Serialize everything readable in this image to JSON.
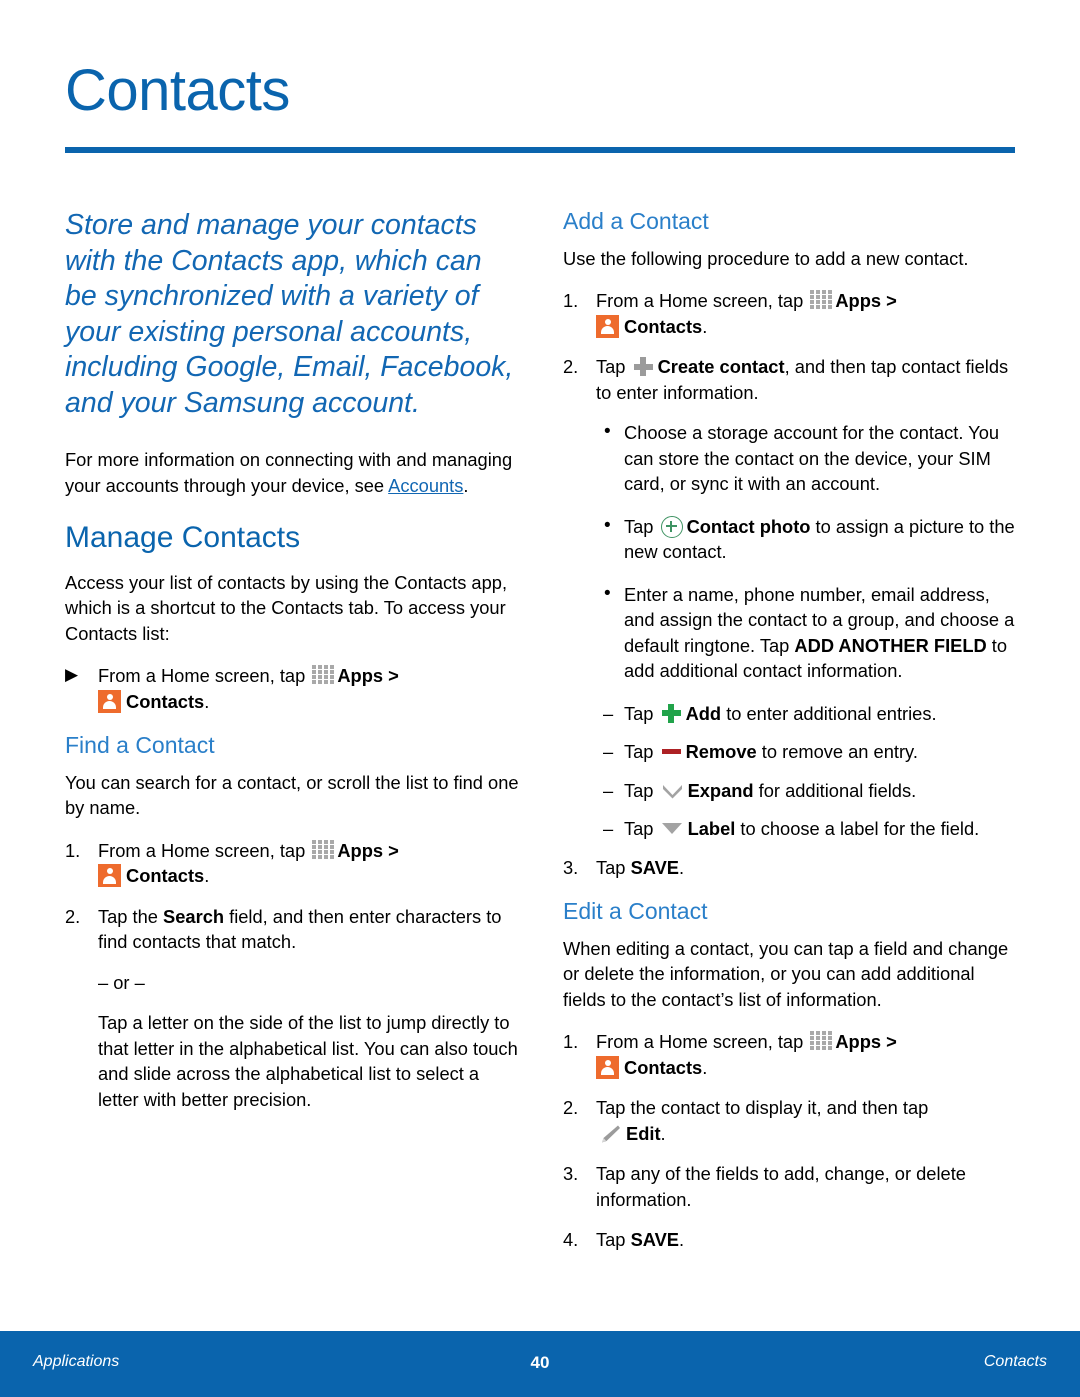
{
  "page": {
    "title": "Contacts",
    "accent_blue": "#0a64ad",
    "subheading_blue": "#2a7fc9",
    "orange": "#ee6b2d",
    "green": "#21a34a",
    "red": "#ad2124"
  },
  "left_column": {
    "lede": "Store and manage your contacts with the Contacts app, which can be synchronized with a variety of your existing personal accounts, including Google, Email, Facebook, and your Samsung account.",
    "intro_before_link": "For more information on connecting with and managing your accounts through your device, see ",
    "intro_link": "Accounts",
    "intro_after_link": ".",
    "manage_heading": "Manage Contacts",
    "manage_body": "Access your list of contacts by using the Contacts app, which is a shortcut to the Contacts tab. To access your Contacts list:",
    "manage_step": {
      "marker": "▶",
      "text_before": "From a Home screen, tap ",
      "apps_label": "Apps",
      "gt": " > ",
      "contacts_label": "Contacts",
      "period": "."
    },
    "find_heading": "Find a Contact",
    "find_body": "You can search for a contact, or scroll the list to find one by name.",
    "find_steps": [
      {
        "marker": "1.",
        "text_before": "From a Home screen, tap ",
        "apps_label": "Apps",
        "gt": " > ",
        "contacts_label": "Contacts",
        "period": "."
      },
      {
        "marker": "2.",
        "text_before": "Tap the ",
        "bold": "Search",
        "text_after": " field, and then enter characters to find contacts that match."
      }
    ],
    "or_separator": "– or –",
    "find_alt_text": "Tap a letter on the side of the list to jump directly to that letter in the alphabetical list. You can also touch and slide across the alphabetical list to select a letter with better precision."
  },
  "right_column": {
    "add_heading": "Add a Contact",
    "add_body": "Use the following procedure to add a new contact.",
    "add_step_1": {
      "marker": "1.",
      "text_before": "From a Home screen, tap ",
      "apps_label": "Apps",
      "gt": " > ",
      "contacts_label": "Contacts",
      "period": "."
    },
    "add_step_2": {
      "marker": "2.",
      "text_before": "Tap ",
      "bold": "Create contact",
      "text_after": ", and then tap contact fields to enter information."
    },
    "add_bullets": [
      {
        "marker": "•",
        "text": "Choose a storage account for the contact. You can store the contact on the device, your SIM card, or sync it with an account."
      }
    ],
    "photo_bullet": {
      "marker": "•",
      "text_before": "Tap ",
      "bold": "Contact photo",
      "text_after": " to assign a picture to the new contact."
    },
    "enter_bullet": {
      "marker": "•",
      "text_before": "Enter a name, phone number, email address, and assign the contact to a group, and choose a default ringtone. Tap ",
      "bold": "ADD ANOTHER FIELD",
      "text_after": " to add additional contact information."
    },
    "field_dashes": [
      {
        "marker": "–",
        "text_before": "Tap ",
        "icon": "plus-green-icon",
        "bold": "Add",
        "text_after": " to enter additional entries."
      },
      {
        "marker": "–",
        "text_before": "Tap ",
        "icon": "remove-icon",
        "bold": "Remove",
        "text_after": " to remove an entry."
      },
      {
        "marker": "–",
        "text_before": "Tap ",
        "icon": "expand-icon",
        "bold": "Expand",
        "text_after": " for additional fields."
      },
      {
        "marker": "–",
        "text_before": "Tap ",
        "icon": "label-icon",
        "bold": "Label",
        "text_after": " to choose a label for the field."
      }
    ],
    "add_step_3": {
      "marker": "3.",
      "text_before": "Tap ",
      "bold": "SAVE",
      "text_after": "."
    },
    "edit_heading": "Edit a Contact",
    "edit_body": "When editing a contact, you can tap a field and change or delete the information, or you can add additional fields to the contact’s list of information.",
    "edit_step_1": {
      "marker": "1.",
      "text_before": "From a Home screen, tap ",
      "apps_label": "Apps",
      "gt": " > ",
      "contacts_label": "Contacts",
      "period": "."
    },
    "edit_step_2": {
      "marker": "2.",
      "text_before": "Tap the contact to display it, and then tap ",
      "bold": "Edit",
      "text_after": "."
    },
    "edit_step_3": {
      "marker": "3.",
      "text": "Tap any of the fields to add, change, or delete information."
    },
    "edit_step_4": {
      "marker": "4.",
      "text_before": "Tap ",
      "bold": "SAVE",
      "text_after": "."
    }
  },
  "footer": {
    "left": "Applications",
    "page_number": "40",
    "right": "Contacts"
  }
}
